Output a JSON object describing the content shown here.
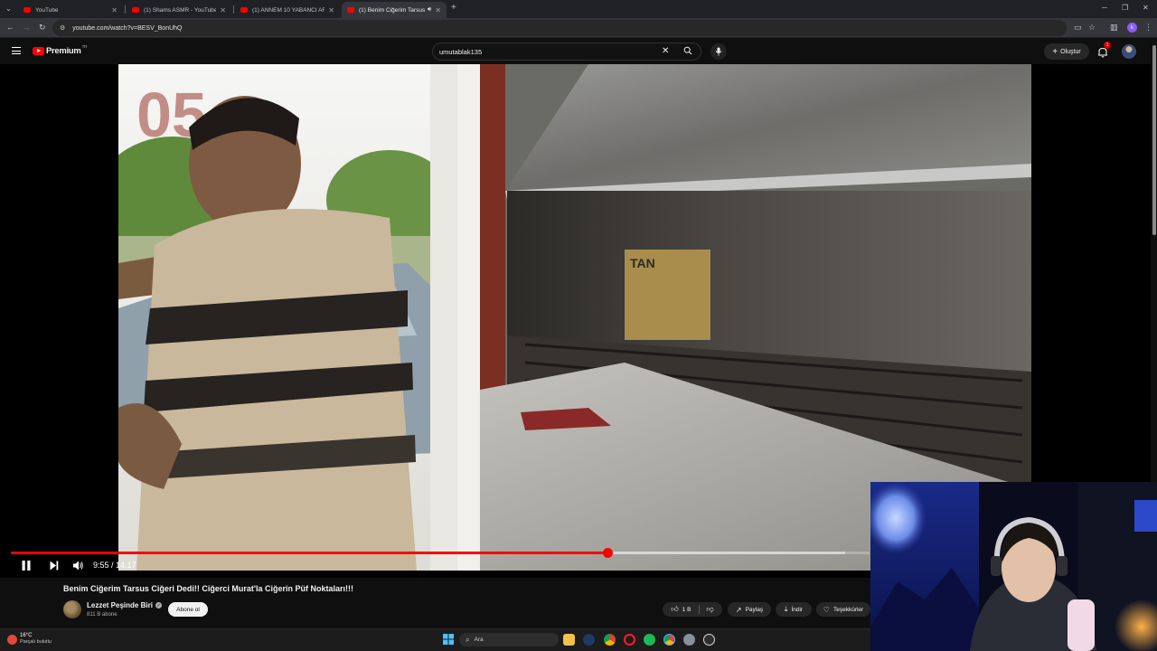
{
  "browser": {
    "tabs": [
      {
        "title": "YouTube",
        "active": false
      },
      {
        "title": "(1) Shams ASMR - YouTube",
        "active": false
      },
      {
        "title": "(1) ANNEM 10 YABANCI ARAST",
        "active": false
      },
      {
        "title": "(1) Benim Ciğerim Tarsus C",
        "active": true
      }
    ],
    "url": "youtube.com/watch?v=BESV_BonUhQ"
  },
  "youtube": {
    "logo_text": "Premium",
    "logo_region": "TR",
    "search_query": "umutablak135",
    "create_label": "Oluştur",
    "notif_count": "1"
  },
  "player": {
    "current_time": "9:55",
    "duration": "14:17",
    "time_display": "9:55 / 14:17",
    "progress_fraction": 0.6948
  },
  "video": {
    "title": "Benim Ciğerim Tarsus Ciğeri Dedi!! Ciğerci Murat'la Ciğerin Püf Noktaları!!!",
    "channel": "Lezzet Peşinde Biri",
    "subscribers": "811 B abone",
    "subscribe_label": "Abone ol",
    "likes": "1 B",
    "share_label": "Paylaş",
    "download_label": "İndir",
    "thanks_label": "Teşekkürler"
  },
  "taskbar": {
    "temp": "16°C",
    "weather": "Parçalı bulutlu",
    "search_label": "Ara"
  },
  "colors": {
    "accent": "#ff0000",
    "background": "#0f0f0f"
  }
}
